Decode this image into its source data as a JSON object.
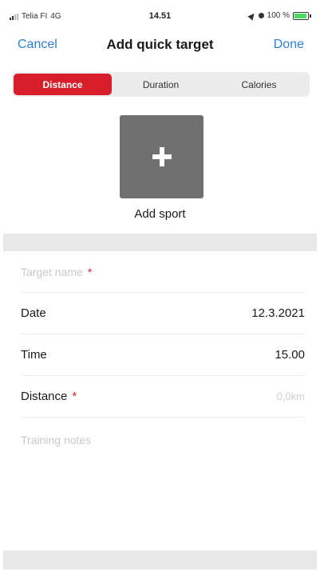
{
  "status_bar": {
    "carrier": "Telia FI",
    "network": "4G",
    "time": "14.51",
    "battery_percent": "100 %",
    "battery_level": 1.0,
    "battery_color": "#4cd964"
  },
  "nav": {
    "cancel_label": "Cancel",
    "title": "Add quick target",
    "done_label": "Done"
  },
  "tabs": [
    {
      "label": "Distance",
      "active": true
    },
    {
      "label": "Duration",
      "active": false
    },
    {
      "label": "Calories",
      "active": false
    }
  ],
  "add_sport": {
    "icon": "plus-icon",
    "label": "Add sport"
  },
  "form": {
    "target_name": {
      "placeholder": "Target name",
      "required_mark": "*"
    },
    "date": {
      "label": "Date",
      "value": "12.3.2021"
    },
    "time": {
      "label": "Time",
      "value": "15.00"
    },
    "distance": {
      "label": "Distance",
      "required_mark": "*",
      "placeholder": "0,0km"
    },
    "notes": {
      "placeholder": "Training notes"
    }
  },
  "colors": {
    "accent_red": "#d81e2b",
    "link_blue": "#2a7fd6",
    "tile_gray": "#6f6f6f"
  }
}
